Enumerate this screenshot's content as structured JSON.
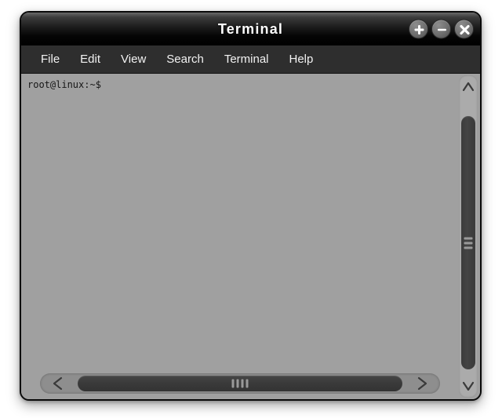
{
  "window": {
    "title": "Terminal",
    "controls": [
      {
        "name": "maximize-button",
        "icon": "plus-icon",
        "label": "+"
      },
      {
        "name": "minimize-button",
        "icon": "minus-icon",
        "label": "−"
      },
      {
        "name": "close-button",
        "icon": "close-icon",
        "label": "×"
      }
    ],
    "colors": {
      "titlebar": "#000000",
      "menubar": "#2e2e2e",
      "terminal_background": "#a0a0a0",
      "terminal_foreground": "#161616",
      "scrollbar_track": "#8e8e8e",
      "scrollbar_thumb": "#3a3a3a",
      "page_background": "#ffffff"
    }
  },
  "menubar": {
    "items": [
      {
        "label": "File"
      },
      {
        "label": "Edit"
      },
      {
        "label": "View"
      },
      {
        "label": "Search"
      },
      {
        "label": "Terminal"
      },
      {
        "label": "Help"
      }
    ]
  },
  "terminal": {
    "prompt": "root@linux:~$",
    "content": "root@linux:~$"
  },
  "scrollbars": {
    "vertical": {
      "up_arrow_icon": "chevron-up-icon",
      "down_arrow_icon": "chevron-down-icon",
      "grip_lines": 3
    },
    "horizontal": {
      "left_arrow_icon": "chevron-left-icon",
      "right_arrow_icon": "chevron-right-icon",
      "grip_lines": 4
    }
  }
}
